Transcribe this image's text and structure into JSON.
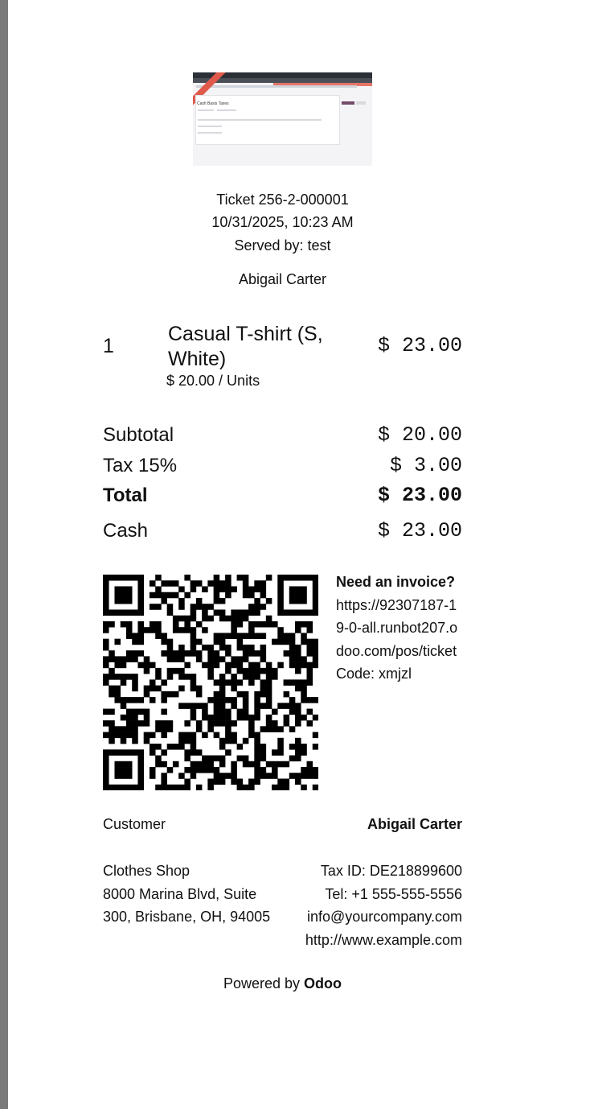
{
  "ticket": {
    "number": "Ticket 256-2-000001",
    "datetime": "10/31/2025, 10:23 AM",
    "served_by": "Served by: test",
    "customer_name": "Abigail Carter"
  },
  "lines": [
    {
      "qty": "1",
      "name": "Casual T-shirt (S, White)",
      "unit_price": "$ 20.00 / Units",
      "amount": "$ 23.00"
    }
  ],
  "totals": {
    "subtotal_label": "Subtotal",
    "subtotal_value": "$ 20.00",
    "tax_label": "Tax 15%",
    "tax_value": "$ 3.00",
    "total_label": "Total",
    "total_value": "$ 23.00",
    "payment_label": "Cash",
    "payment_value": "$ 23.00"
  },
  "invoice": {
    "heading": "Need an invoice?",
    "url": "https://92307187-19-0-all.runbot207.odoo.com/pos/ticket",
    "code": "Code: xmjzl"
  },
  "customer_row": {
    "label": "Customer",
    "name": "Abigail Carter"
  },
  "company": {
    "name": "Clothes Shop",
    "address": "8000 Marina Blvd, Suite 300, Brisbane, OH, 94005",
    "tax_id": "Tax ID: DE218899600",
    "tel": "Tel: +1 555-555-5556",
    "email": "info@yourcompany.com",
    "website": "http://www.example.com"
  },
  "footer": {
    "powered_by": "Powered by",
    "brand": "Odoo"
  },
  "logo": {
    "title": "Cash Basis Taxes"
  }
}
